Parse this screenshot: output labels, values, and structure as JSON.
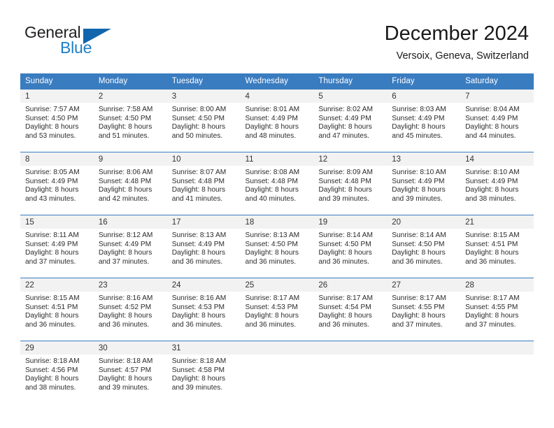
{
  "brand": {
    "name_part1": "General",
    "name_part2": "Blue",
    "accent_color": "#1f7ec4",
    "triangle_color": "#1266ad"
  },
  "header": {
    "month_title": "December 2024",
    "location": "Versoix, Geneva, Switzerland"
  },
  "calendar": {
    "header_bg": "#3a7cc0",
    "weekdays": [
      "Sunday",
      "Monday",
      "Tuesday",
      "Wednesday",
      "Thursday",
      "Friday",
      "Saturday"
    ],
    "weeks": [
      [
        {
          "day": "1",
          "sunrise": "Sunrise: 7:57 AM",
          "sunset": "Sunset: 4:50 PM",
          "daylight_line1": "Daylight: 8 hours",
          "daylight_line2": "and 53 minutes."
        },
        {
          "day": "2",
          "sunrise": "Sunrise: 7:58 AM",
          "sunset": "Sunset: 4:50 PM",
          "daylight_line1": "Daylight: 8 hours",
          "daylight_line2": "and 51 minutes."
        },
        {
          "day": "3",
          "sunrise": "Sunrise: 8:00 AM",
          "sunset": "Sunset: 4:50 PM",
          "daylight_line1": "Daylight: 8 hours",
          "daylight_line2": "and 50 minutes."
        },
        {
          "day": "4",
          "sunrise": "Sunrise: 8:01 AM",
          "sunset": "Sunset: 4:49 PM",
          "daylight_line1": "Daylight: 8 hours",
          "daylight_line2": "and 48 minutes."
        },
        {
          "day": "5",
          "sunrise": "Sunrise: 8:02 AM",
          "sunset": "Sunset: 4:49 PM",
          "daylight_line1": "Daylight: 8 hours",
          "daylight_line2": "and 47 minutes."
        },
        {
          "day": "6",
          "sunrise": "Sunrise: 8:03 AM",
          "sunset": "Sunset: 4:49 PM",
          "daylight_line1": "Daylight: 8 hours",
          "daylight_line2": "and 45 minutes."
        },
        {
          "day": "7",
          "sunrise": "Sunrise: 8:04 AM",
          "sunset": "Sunset: 4:49 PM",
          "daylight_line1": "Daylight: 8 hours",
          "daylight_line2": "and 44 minutes."
        }
      ],
      [
        {
          "day": "8",
          "sunrise": "Sunrise: 8:05 AM",
          "sunset": "Sunset: 4:49 PM",
          "daylight_line1": "Daylight: 8 hours",
          "daylight_line2": "and 43 minutes."
        },
        {
          "day": "9",
          "sunrise": "Sunrise: 8:06 AM",
          "sunset": "Sunset: 4:48 PM",
          "daylight_line1": "Daylight: 8 hours",
          "daylight_line2": "and 42 minutes."
        },
        {
          "day": "10",
          "sunrise": "Sunrise: 8:07 AM",
          "sunset": "Sunset: 4:48 PM",
          "daylight_line1": "Daylight: 8 hours",
          "daylight_line2": "and 41 minutes."
        },
        {
          "day": "11",
          "sunrise": "Sunrise: 8:08 AM",
          "sunset": "Sunset: 4:48 PM",
          "daylight_line1": "Daylight: 8 hours",
          "daylight_line2": "and 40 minutes."
        },
        {
          "day": "12",
          "sunrise": "Sunrise: 8:09 AM",
          "sunset": "Sunset: 4:48 PM",
          "daylight_line1": "Daylight: 8 hours",
          "daylight_line2": "and 39 minutes."
        },
        {
          "day": "13",
          "sunrise": "Sunrise: 8:10 AM",
          "sunset": "Sunset: 4:49 PM",
          "daylight_line1": "Daylight: 8 hours",
          "daylight_line2": "and 39 minutes."
        },
        {
          "day": "14",
          "sunrise": "Sunrise: 8:10 AM",
          "sunset": "Sunset: 4:49 PM",
          "daylight_line1": "Daylight: 8 hours",
          "daylight_line2": "and 38 minutes."
        }
      ],
      [
        {
          "day": "15",
          "sunrise": "Sunrise: 8:11 AM",
          "sunset": "Sunset: 4:49 PM",
          "daylight_line1": "Daylight: 8 hours",
          "daylight_line2": "and 37 minutes."
        },
        {
          "day": "16",
          "sunrise": "Sunrise: 8:12 AM",
          "sunset": "Sunset: 4:49 PM",
          "daylight_line1": "Daylight: 8 hours",
          "daylight_line2": "and 37 minutes."
        },
        {
          "day": "17",
          "sunrise": "Sunrise: 8:13 AM",
          "sunset": "Sunset: 4:49 PM",
          "daylight_line1": "Daylight: 8 hours",
          "daylight_line2": "and 36 minutes."
        },
        {
          "day": "18",
          "sunrise": "Sunrise: 8:13 AM",
          "sunset": "Sunset: 4:50 PM",
          "daylight_line1": "Daylight: 8 hours",
          "daylight_line2": "and 36 minutes."
        },
        {
          "day": "19",
          "sunrise": "Sunrise: 8:14 AM",
          "sunset": "Sunset: 4:50 PM",
          "daylight_line1": "Daylight: 8 hours",
          "daylight_line2": "and 36 minutes."
        },
        {
          "day": "20",
          "sunrise": "Sunrise: 8:14 AM",
          "sunset": "Sunset: 4:50 PM",
          "daylight_line1": "Daylight: 8 hours",
          "daylight_line2": "and 36 minutes."
        },
        {
          "day": "21",
          "sunrise": "Sunrise: 8:15 AM",
          "sunset": "Sunset: 4:51 PM",
          "daylight_line1": "Daylight: 8 hours",
          "daylight_line2": "and 36 minutes."
        }
      ],
      [
        {
          "day": "22",
          "sunrise": "Sunrise: 8:15 AM",
          "sunset": "Sunset: 4:51 PM",
          "daylight_line1": "Daylight: 8 hours",
          "daylight_line2": "and 36 minutes."
        },
        {
          "day": "23",
          "sunrise": "Sunrise: 8:16 AM",
          "sunset": "Sunset: 4:52 PM",
          "daylight_line1": "Daylight: 8 hours",
          "daylight_line2": "and 36 minutes."
        },
        {
          "day": "24",
          "sunrise": "Sunrise: 8:16 AM",
          "sunset": "Sunset: 4:53 PM",
          "daylight_line1": "Daylight: 8 hours",
          "daylight_line2": "and 36 minutes."
        },
        {
          "day": "25",
          "sunrise": "Sunrise: 8:17 AM",
          "sunset": "Sunset: 4:53 PM",
          "daylight_line1": "Daylight: 8 hours",
          "daylight_line2": "and 36 minutes."
        },
        {
          "day": "26",
          "sunrise": "Sunrise: 8:17 AM",
          "sunset": "Sunset: 4:54 PM",
          "daylight_line1": "Daylight: 8 hours",
          "daylight_line2": "and 36 minutes."
        },
        {
          "day": "27",
          "sunrise": "Sunrise: 8:17 AM",
          "sunset": "Sunset: 4:55 PM",
          "daylight_line1": "Daylight: 8 hours",
          "daylight_line2": "and 37 minutes."
        },
        {
          "day": "28",
          "sunrise": "Sunrise: 8:17 AM",
          "sunset": "Sunset: 4:55 PM",
          "daylight_line1": "Daylight: 8 hours",
          "daylight_line2": "and 37 minutes."
        }
      ],
      [
        {
          "day": "29",
          "sunrise": "Sunrise: 8:18 AM",
          "sunset": "Sunset: 4:56 PM",
          "daylight_line1": "Daylight: 8 hours",
          "daylight_line2": "and 38 minutes."
        },
        {
          "day": "30",
          "sunrise": "Sunrise: 8:18 AM",
          "sunset": "Sunset: 4:57 PM",
          "daylight_line1": "Daylight: 8 hours",
          "daylight_line2": "and 39 minutes."
        },
        {
          "day": "31",
          "sunrise": "Sunrise: 8:18 AM",
          "sunset": "Sunset: 4:58 PM",
          "daylight_line1": "Daylight: 8 hours",
          "daylight_line2": "and 39 minutes."
        },
        {
          "day": "",
          "sunrise": "",
          "sunset": "",
          "daylight_line1": "",
          "daylight_line2": ""
        },
        {
          "day": "",
          "sunrise": "",
          "sunset": "",
          "daylight_line1": "",
          "daylight_line2": ""
        },
        {
          "day": "",
          "sunrise": "",
          "sunset": "",
          "daylight_line1": "",
          "daylight_line2": ""
        },
        {
          "day": "",
          "sunrise": "",
          "sunset": "",
          "daylight_line1": "",
          "daylight_line2": ""
        }
      ]
    ]
  }
}
